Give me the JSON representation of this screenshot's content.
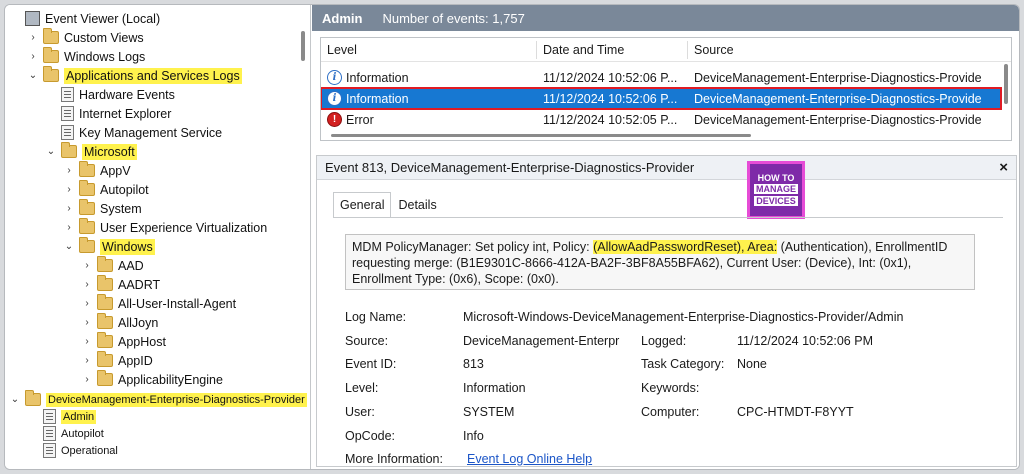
{
  "tree": {
    "items": [
      {
        "label": "Event Viewer (Local)",
        "icon": "event-viewer-icon",
        "indent": 0,
        "twisty": ""
      },
      {
        "label": "Custom Views",
        "icon": "folder-icon",
        "indent": 1,
        "twisty": "›"
      },
      {
        "label": "Windows Logs",
        "icon": "folder-icon",
        "indent": 1,
        "twisty": "›"
      },
      {
        "label": "Applications and Services Logs",
        "icon": "folder-icon",
        "indent": 1,
        "twisty": "⌄",
        "highlight": true
      },
      {
        "label": "Hardware Events",
        "icon": "log-icon",
        "indent": 2,
        "twisty": ""
      },
      {
        "label": "Internet Explorer",
        "icon": "log-icon",
        "indent": 2,
        "twisty": ""
      },
      {
        "label": "Key Management Service",
        "icon": "log-icon",
        "indent": 2,
        "twisty": ""
      },
      {
        "label": "Microsoft",
        "icon": "folder-icon",
        "indent": 2,
        "twisty": "⌄",
        "highlight": true
      },
      {
        "label": "AppV",
        "icon": "folder-icon",
        "indent": 3,
        "twisty": "›"
      },
      {
        "label": "Autopilot",
        "icon": "folder-icon",
        "indent": 3,
        "twisty": "›"
      },
      {
        "label": "System",
        "icon": "folder-icon",
        "indent": 3,
        "twisty": "›"
      },
      {
        "label": "User Experience Virtualization",
        "icon": "folder-icon",
        "indent": 3,
        "twisty": "›"
      },
      {
        "label": "Windows",
        "icon": "folder-icon",
        "indent": 3,
        "twisty": "⌄",
        "highlight": true
      },
      {
        "label": "AAD",
        "icon": "folder-icon",
        "indent": 4,
        "twisty": "›"
      },
      {
        "label": "AADRT",
        "icon": "folder-icon",
        "indent": 4,
        "twisty": "›"
      },
      {
        "label": "All-User-Install-Agent",
        "icon": "folder-icon",
        "indent": 4,
        "twisty": "›"
      },
      {
        "label": "AllJoyn",
        "icon": "folder-icon",
        "indent": 4,
        "twisty": "›"
      },
      {
        "label": "AppHost",
        "icon": "folder-icon",
        "indent": 4,
        "twisty": "›"
      },
      {
        "label": "AppID",
        "icon": "folder-icon",
        "indent": 4,
        "twisty": "›"
      },
      {
        "label": "ApplicabilityEngine",
        "icon": "folder-icon",
        "indent": 4,
        "twisty": "›"
      }
    ],
    "bottom": [
      {
        "label": "DeviceManagement-Enterprise-Diagnostics-Provider",
        "icon": "folder-icon",
        "indent": 0,
        "twisty": "⌄",
        "highlight": true
      },
      {
        "label": "Admin",
        "icon": "log-icon",
        "indent": 1,
        "twisty": "",
        "highlight": true
      },
      {
        "label": "Autopilot",
        "icon": "log-icon",
        "indent": 1,
        "twisty": ""
      },
      {
        "label": "Operational",
        "icon": "log-icon",
        "indent": 1,
        "twisty": ""
      }
    ]
  },
  "header": {
    "title": "Admin",
    "count": "Number of events: 1,757"
  },
  "grid": {
    "columns": [
      "Level",
      "Date and Time",
      "Source"
    ],
    "rows": [
      {
        "level": "Information",
        "icon": "info-icon",
        "date": "11/12/2024 10:52:06 P...",
        "source": "DeviceManagement-Enterprise-Diagnostics-Provide"
      },
      {
        "level": "Information",
        "icon": "info-icon",
        "date": "11/12/2024 10:52:06 P...",
        "source": "DeviceManagement-Enterprise-Diagnostics-Provide",
        "selected": true
      },
      {
        "level": "Error",
        "icon": "error-icon",
        "date": "11/12/2024 10:52:05 P...",
        "source": "DeviceManagement-Enterprise-Diagnostics-Provide"
      }
    ]
  },
  "detail": {
    "title": "Event 813, DeviceManagement-Enterprise-Diagnostics-Provider",
    "close": "×",
    "tabs": [
      "General",
      "Details"
    ],
    "message": {
      "pre": "MDM PolicyManager: Set policy int, Policy: ",
      "hl1": "(AllowAadPasswordReset), Area:",
      "post": " (Authentication), EnrollmentID requesting merge: (B1E9301C-8666-412A-BA2F-3BF8A55BFA62), Current User: (Device), Int: (0x1), Enrollment Type: (0x6), Scope: (0x0)."
    },
    "logo": {
      "line1": "HOW TO",
      "line2": "MANAGE",
      "line3": "DEVICES"
    },
    "props": {
      "log_name_label": "Log Name:",
      "log_name": "Microsoft-Windows-DeviceManagement-Enterprise-Diagnostics-Provider/Admin",
      "source_label": "Source:",
      "source": "DeviceManagement-Enterpr",
      "logged_label": "Logged:",
      "logged": "11/12/2024 10:52:06 PM",
      "event_id_label": "Event ID:",
      "event_id": "813",
      "task_label": "Task Category:",
      "task": "None",
      "level_label": "Level:",
      "level": "Information",
      "keywords_label": "Keywords:",
      "keywords": "",
      "user_label": "User:",
      "user": "SYSTEM",
      "computer_label": "Computer:",
      "computer": "CPC-HTMDT-F8YYT",
      "opcode_label": "OpCode:",
      "opcode": "Info",
      "more_label": "More Information:",
      "more_link": "Event Log Online Help"
    }
  }
}
